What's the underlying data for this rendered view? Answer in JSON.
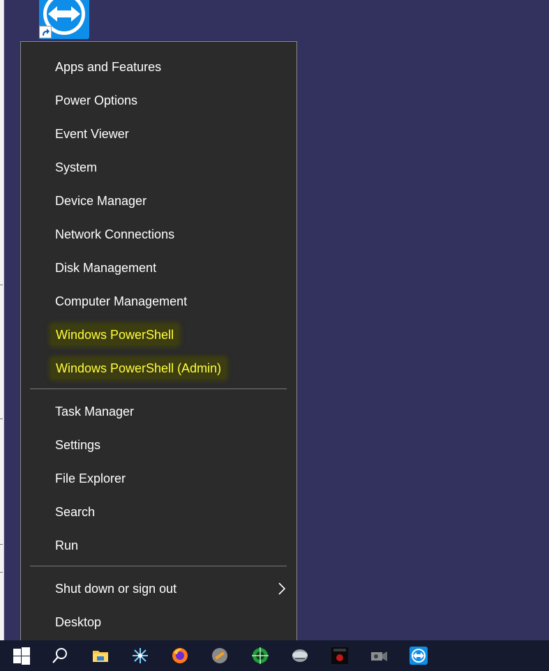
{
  "menu": {
    "items": [
      {
        "label": "Apps and Features",
        "highlight": false
      },
      {
        "label": "Power Options",
        "highlight": false
      },
      {
        "label": "Event Viewer",
        "highlight": false
      },
      {
        "label": "System",
        "highlight": false
      },
      {
        "label": "Device Manager",
        "highlight": false
      },
      {
        "label": "Network Connections",
        "highlight": false
      },
      {
        "label": "Disk Management",
        "highlight": false
      },
      {
        "label": "Computer Management",
        "highlight": false
      },
      {
        "label": "Windows PowerShell",
        "highlight": true
      },
      {
        "label": "Windows PowerShell (Admin)",
        "highlight": true
      },
      {
        "label": "Task Manager",
        "highlight": false
      },
      {
        "label": "Settings",
        "highlight": false
      },
      {
        "label": "File Explorer",
        "highlight": false
      },
      {
        "label": "Search",
        "highlight": false
      },
      {
        "label": "Run",
        "highlight": false
      },
      {
        "label": "Shut down or sign out",
        "highlight": false
      },
      {
        "label": "Desktop",
        "highlight": false
      }
    ]
  },
  "colors": {
    "desktop_background": "#33325f",
    "menu_background": "#2b2b2b",
    "highlight_text": "#ffff3a",
    "taskbar_background": "#151a2f"
  },
  "desktop": {
    "icons": [
      {
        "icon": "teamviewer-shortcut-icon"
      }
    ]
  },
  "taskbar": {
    "icons": [
      "windows-start-icon",
      "search-icon",
      "file-explorer-icon",
      "snowflake-app-icon",
      "firefox-icon",
      "tool-app-icon",
      "green-target-app-icon",
      "disk-app-icon",
      "media-app-icon",
      "camera-app-icon",
      "teamviewer-icon"
    ]
  }
}
